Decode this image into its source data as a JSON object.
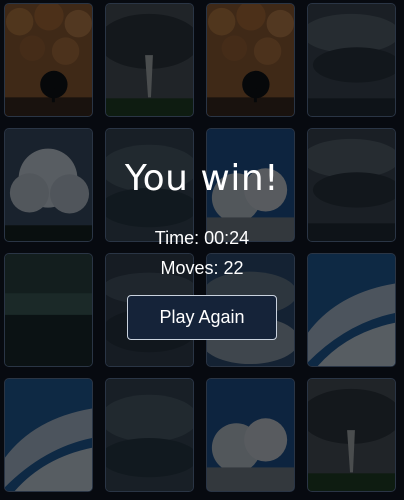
{
  "board": {
    "columns": 4,
    "rows": 4,
    "cards": [
      {
        "image": "mammatus-clouds-with-tree"
      },
      {
        "image": "tornado-over-field"
      },
      {
        "image": "mammatus-clouds-with-tree"
      },
      {
        "image": "storm-clouds-dark"
      },
      {
        "image": "cumulonimbus-tower"
      },
      {
        "image": "storm-clouds-dark-2"
      },
      {
        "image": "clouds-blue-sky"
      },
      {
        "image": "storm-clouds-dark"
      },
      {
        "image": "shelf-cloud-green"
      },
      {
        "image": "cirrus-clouds-dark"
      },
      {
        "image": "cloudy-blue-sky"
      },
      {
        "image": "cirrus-clouds-blue"
      },
      {
        "image": "cirrus-clouds-blue"
      },
      {
        "image": "storm-clouds-dark-2"
      },
      {
        "image": "clouds-blue-sky"
      },
      {
        "image": "tornado-over-field"
      }
    ]
  },
  "result": {
    "title": "You win!",
    "time": "Time: 00:24",
    "moves": "Moves: 22",
    "play_again_label": "Play Again"
  },
  "colors": {
    "background": "#070a10",
    "button_fill": "#152339",
    "button_border": "#c9d2de",
    "text": "#ffffff"
  }
}
